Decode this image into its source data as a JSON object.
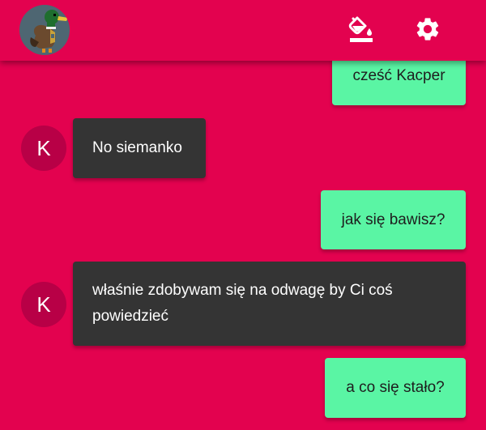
{
  "app": {
    "accent_color": "#E3024F",
    "sent_bubble_color": "#5AF5A4",
    "received_bubble_color": "#343434",
    "avatar_color": "#B80046"
  },
  "appbar": {
    "user_avatar": "duck-avatar",
    "actions": [
      {
        "icon": "paint-bucket-icon"
      },
      {
        "icon": "gear-icon"
      }
    ]
  },
  "messages": [
    {
      "direction": "sent",
      "text": "cześć Kacper"
    },
    {
      "direction": "received",
      "avatar_letter": "K",
      "text": "No siemanko"
    },
    {
      "direction": "sent",
      "text": "jak się bawisz?"
    },
    {
      "direction": "received",
      "avatar_letter": "K",
      "text": "właśnie zdobywam się na odwagę by Ci coś powiedzieć"
    },
    {
      "direction": "sent",
      "text": "a co się stało?"
    }
  ]
}
